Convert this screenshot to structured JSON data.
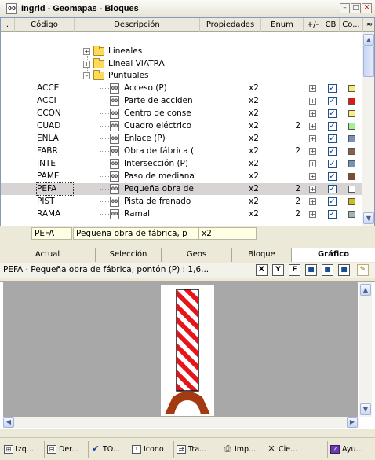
{
  "window": {
    "title": "Ingrid - Geomapas - Bloques",
    "app_icon_text": "00"
  },
  "columns": [
    {
      "label": "."
    },
    {
      "label": "Código"
    },
    {
      "label": "Descripción"
    },
    {
      "label": "Propiedades"
    },
    {
      "label": "Enum"
    },
    {
      "label": "+/-"
    },
    {
      "label": "CB"
    },
    {
      "label": "Co..."
    },
    {
      "label": "≈"
    }
  ],
  "tree": {
    "groups": [
      {
        "label": "Lineales",
        "expanded": false
      },
      {
        "label": "Lineal VIATRA",
        "expanded": false
      },
      {
        "label": "Puntuales",
        "expanded": true
      }
    ],
    "rows": [
      {
        "code": "ACCE",
        "desc": "Acceso (P)",
        "prop": "x2",
        "enum": "",
        "cb": true,
        "color": "#f3ee76"
      },
      {
        "code": "ACCI",
        "desc": "Parte de acciden",
        "prop": "x2",
        "enum": "",
        "cb": true,
        "color": "#e01717"
      },
      {
        "code": "CCON",
        "desc": "Centro de conse",
        "prop": "x2",
        "enum": "",
        "cb": true,
        "color": "#f4f17a"
      },
      {
        "code": "CUAD",
        "desc": "Cuadro eléctrico",
        "prop": "x2",
        "enum": "2",
        "cb": true,
        "color": "#a5ef9a"
      },
      {
        "code": "ENLA",
        "desc": "Enlace (P)",
        "prop": "x2",
        "enum": "",
        "cb": true,
        "color": "#7393ba"
      },
      {
        "code": "FABR",
        "desc": "Obra de fábrica (",
        "prop": "x2",
        "enum": "2",
        "cb": true,
        "color": "#8e5d4b"
      },
      {
        "code": "INTE",
        "desc": "Intersección (P)",
        "prop": "x2",
        "enum": "",
        "cb": true,
        "color": "#7393ba"
      },
      {
        "code": "PAME",
        "desc": "Paso de mediana",
        "prop": "x2",
        "enum": "",
        "cb": true,
        "color": "#8d4a1c"
      },
      {
        "code": "PEFA",
        "desc": "Pequeña obra de",
        "prop": "x2",
        "enum": "2",
        "cb": true,
        "color": "#ffffff",
        "selected": true
      },
      {
        "code": "PIST",
        "desc": "Pista de frenado",
        "prop": "x2",
        "enum": "2",
        "cb": true,
        "color": "#d3bd17"
      },
      {
        "code": "RAMA",
        "desc": "Ramal",
        "prop": "x2",
        "enum": "2",
        "cb": true,
        "color": "#9fb5b2"
      }
    ],
    "leaf_icon_text": "00"
  },
  "edit": {
    "code": "PEFA",
    "desc": "Pequeña obra de fábrica, p",
    "prop": "x2"
  },
  "tabs": [
    {
      "label": "Actual",
      "active": false
    },
    {
      "label": "Selección",
      "active": false
    },
    {
      "label": "Geos",
      "active": false
    },
    {
      "label": "Bloque",
      "active": false
    },
    {
      "label": "Gráfico",
      "active": true
    }
  ],
  "preview": {
    "info": "PEFA · Pequeña obra de fábrica, pontón (P) : 1,6...",
    "toolbar": [
      {
        "label": "X",
        "icon": "x-axis-icon"
      },
      {
        "label": "Y",
        "icon": "y-axis-icon"
      },
      {
        "label": "F",
        "icon": "fill-icon"
      },
      {
        "label": "■",
        "icon": "save-icon"
      },
      {
        "label": "■",
        "icon": "save-as-icon"
      },
      {
        "label": "■",
        "icon": "save-all-icon"
      },
      {
        "label": "✎",
        "icon": "edit-icon"
      }
    ],
    "symbol_colors": {
      "stripe_red": "#e8141a",
      "base": "#a43a12"
    }
  },
  "status_buttons": [
    {
      "label": "Izq...",
      "icon": "left-panel-icon",
      "glyph": "⊞"
    },
    {
      "label": "Der...",
      "icon": "right-panel-icon",
      "glyph": "⊟"
    },
    {
      "label": "TO...",
      "icon": "check-all-icon",
      "glyph": "✔"
    },
    {
      "label": "Icono",
      "icon": "icon-info-icon",
      "glyph": "!"
    },
    {
      "label": "Tra...",
      "icon": "transfer-icon",
      "glyph": "⇄"
    },
    {
      "label": "Imp...",
      "icon": "print-icon",
      "glyph": "⎙"
    },
    {
      "label": "Cie...",
      "icon": "close-icon",
      "glyph": "✕"
    },
    {
      "label": "Ayu...",
      "icon": "help-book-icon",
      "glyph": "?"
    }
  ]
}
